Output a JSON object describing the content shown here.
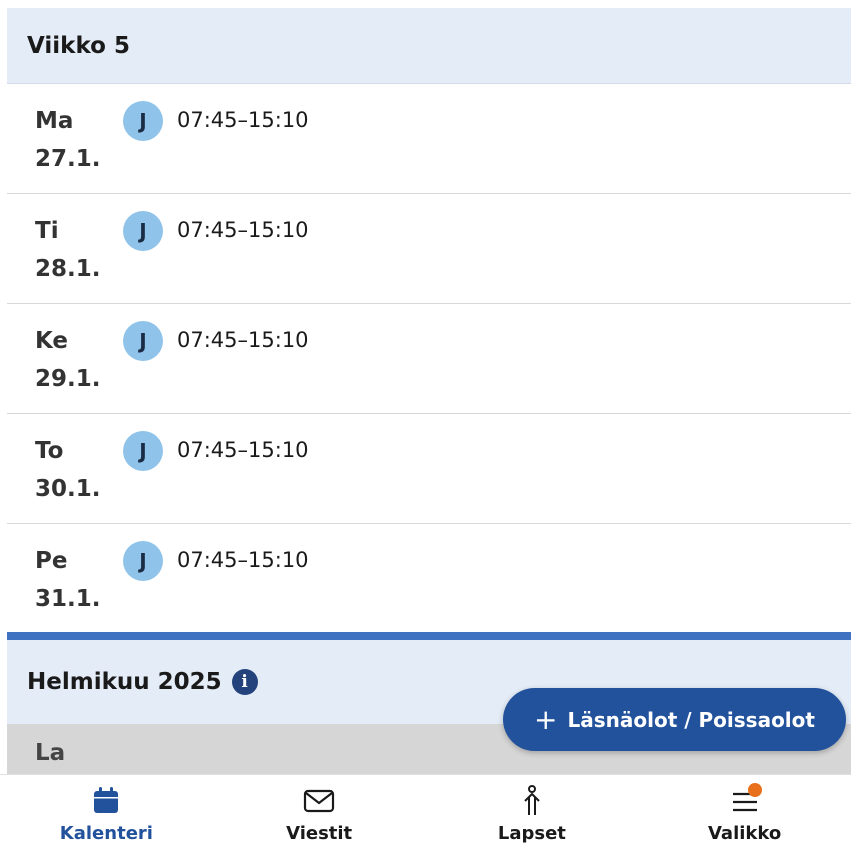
{
  "week": {
    "title": "Viikko 5"
  },
  "days": [
    {
      "weekday": "Ma",
      "date": "27.1.",
      "avatar": "J",
      "time": "07:45–15:10"
    },
    {
      "weekday": "Ti",
      "date": "28.1.",
      "avatar": "J",
      "time": "07:45–15:10"
    },
    {
      "weekday": "Ke",
      "date": "29.1.",
      "avatar": "J",
      "time": "07:45–15:10"
    },
    {
      "weekday": "To",
      "date": "30.1.",
      "avatar": "J",
      "time": "07:45–15:10"
    },
    {
      "weekday": "Pe",
      "date": "31.1.",
      "avatar": "J",
      "time": "07:45–15:10"
    }
  ],
  "month": {
    "title": "Helmikuu 2025",
    "info_icon": "info-icon"
  },
  "next_row": {
    "weekday": "La"
  },
  "fab": {
    "plus": "+",
    "label": "Läsnäolot / Poissaolot"
  },
  "nav": {
    "items": [
      {
        "label": "Kalenteri",
        "icon": "calendar-icon",
        "active": true
      },
      {
        "label": "Viestit",
        "icon": "envelope-icon",
        "active": false
      },
      {
        "label": "Lapset",
        "icon": "child-icon",
        "active": false
      },
      {
        "label": "Valikko",
        "icon": "menu-icon",
        "active": false
      }
    ]
  },
  "colors": {
    "header_bg": "#e4ecf7",
    "accent": "#23529c",
    "avatar": "#8fc3ea",
    "divider": "#3f72c0",
    "badge": "#e8701a"
  }
}
